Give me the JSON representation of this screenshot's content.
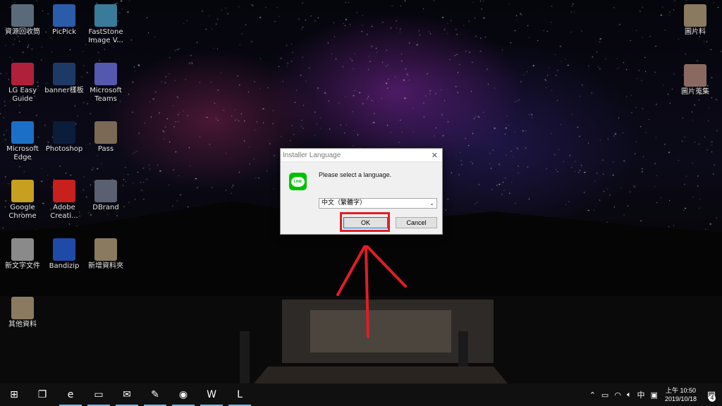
{
  "desktop": {
    "left_icons": [
      {
        "label": "資源回收筒",
        "icon": "recycle-bin-icon",
        "color": "#5a6a7a"
      },
      {
        "label": "PicPick",
        "icon": "picpick-icon",
        "color": "#2a5caa"
      },
      {
        "label": "FastStone Image V...",
        "icon": "faststone-icon",
        "color": "#3a7a9a"
      },
      {
        "label": "LG Easy Guide",
        "icon": "lg-easy-guide-icon",
        "color": "#b0203a"
      },
      {
        "label": "banner樣板",
        "icon": "psd-file-icon",
        "color": "#1d3a66"
      },
      {
        "label": "Microsoft Teams",
        "icon": "teams-icon",
        "color": "#5558af"
      },
      {
        "label": "Microsoft Edge",
        "icon": "edge-icon",
        "color": "#1c6fc6"
      },
      {
        "label": "Photoshop",
        "icon": "photoshop-icon",
        "color": "#0b1d3a"
      },
      {
        "label": "Pass",
        "icon": "folder-icon",
        "color": "#7a6a55"
      },
      {
        "label": "Google Chrome",
        "icon": "chrome-icon",
        "color": "#c8a020"
      },
      {
        "label": "Adobe Creati...",
        "icon": "creative-cloud-icon",
        "color": "#c81f1f"
      },
      {
        "label": "DBrand",
        "icon": "shortcut-icon",
        "color": "#5a6070"
      },
      {
        "label": "新文字文件",
        "icon": "text-file-icon",
        "color": "#8a8a8a"
      },
      {
        "label": "Bandizip",
        "icon": "bandizip-icon",
        "color": "#1f4aa8"
      },
      {
        "label": "新增資料夾",
        "icon": "folder-icon",
        "color": "#8a7a60"
      },
      {
        "label": "其他資料",
        "icon": "folder-icon",
        "color": "#8a7a60"
      }
    ],
    "right_icons": [
      {
        "label": "圖片料",
        "icon": "folder-icon",
        "color": "#8a7a60"
      },
      {
        "label": "圖片蒐集",
        "icon": "folder-icon",
        "color": "#8a6a60"
      }
    ]
  },
  "dialog": {
    "title": "Installer Language",
    "close_glyph": "✕",
    "logo_text": "LINE",
    "prompt": "Please select a language.",
    "language_value": "中文（繁體字）",
    "ok_label": "OK",
    "cancel_label": "Cancel"
  },
  "annotation": {
    "highlight_color": "#e01e25"
  },
  "taskbar": {
    "apps": [
      {
        "icon": "start-windows-icon",
        "glyph": "⊞"
      },
      {
        "icon": "task-view-icon",
        "glyph": "❐"
      },
      {
        "icon": "edge-icon",
        "glyph": "e"
      },
      {
        "icon": "file-explorer-icon",
        "glyph": "▭"
      },
      {
        "icon": "mail-icon",
        "glyph": "✉"
      },
      {
        "icon": "notepad-icon",
        "glyph": "✎"
      },
      {
        "icon": "chrome-icon",
        "glyph": "◉"
      },
      {
        "icon": "word-icon",
        "glyph": "W"
      },
      {
        "icon": "line-icon",
        "glyph": "L"
      }
    ],
    "tray": {
      "ime": "中",
      "time": "上午 10:50",
      "date": "2019/10/18",
      "notification_count": "4"
    }
  }
}
